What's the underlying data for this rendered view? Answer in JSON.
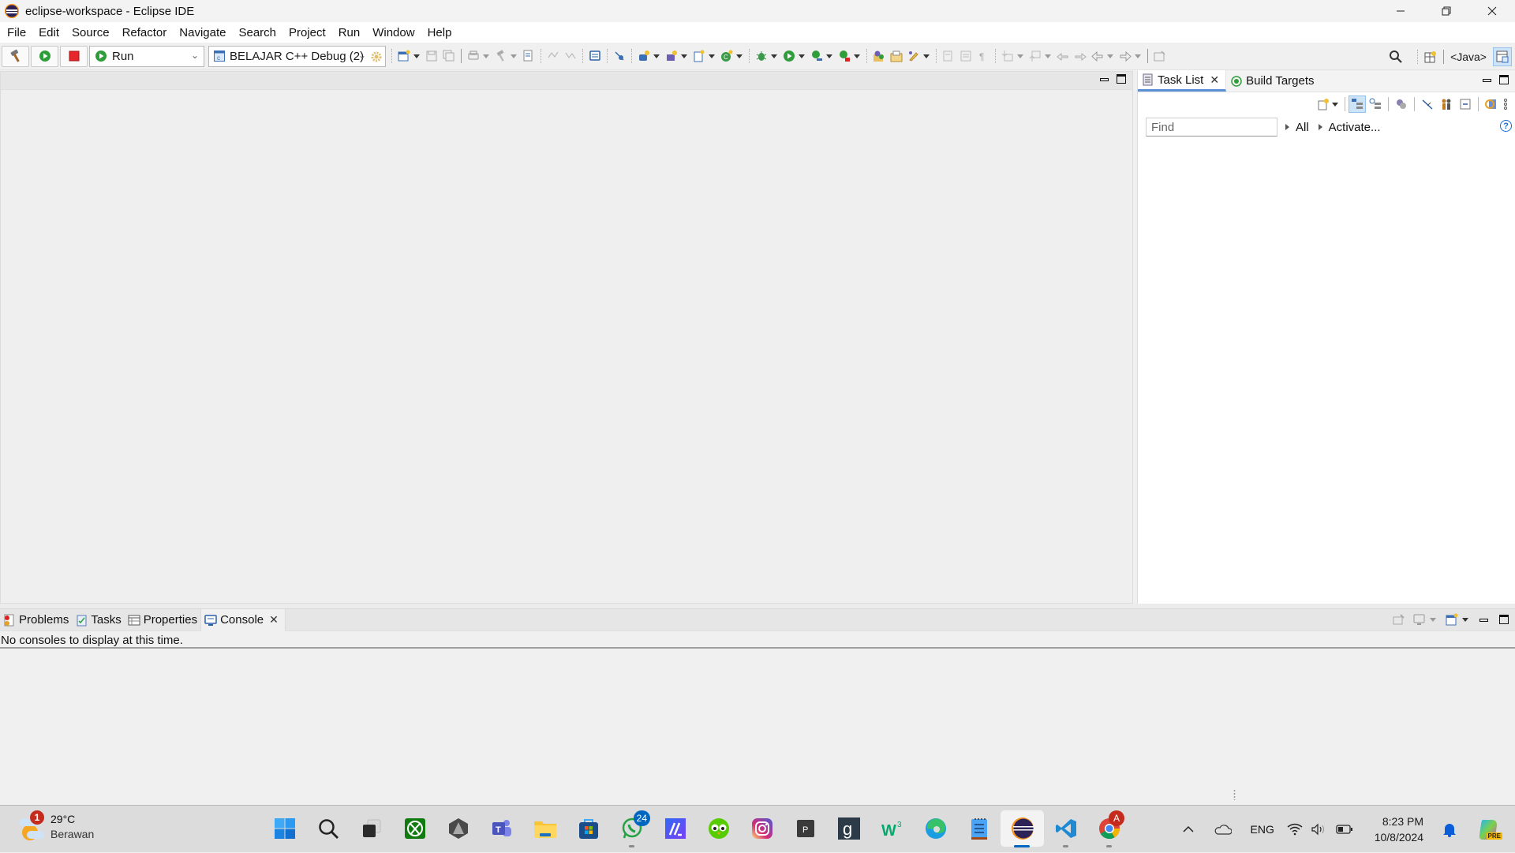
{
  "window": {
    "title": "eclipse-workspace - Eclipse IDE",
    "controls": [
      "minimize",
      "restore",
      "close"
    ]
  },
  "menubar": {
    "items": [
      "File",
      "Edit",
      "Source",
      "Refactor",
      "Navigate",
      "Search",
      "Project",
      "Run",
      "Window",
      "Help"
    ]
  },
  "toolbar": {
    "launch_mode": "Run",
    "launch_config": "BELAJAR C++ Debug (2)",
    "perspective_label": "<Java>",
    "icons": [
      "build-hammer-icon",
      "run-launch-icon",
      "stop-icon",
      "launch-mode-combo",
      "launch-config-combo",
      "launch-config-settings-icon",
      "new-wizard-icon",
      "save-icon",
      "save-all-icon",
      "print-icon",
      "build-icon",
      "open-task-icon",
      "undo-icon",
      "redo-icon",
      "toggle-console-icon",
      "skip-breakpoints-icon",
      "new-class-icon",
      "new-package-icon",
      "new-file-icon",
      "new-source-icon",
      "debug-icon",
      "run-icon",
      "coverage-icon",
      "external-tools-icon",
      "open-type-icon",
      "open-resource-icon",
      "search-pen-icon",
      "toggle-mark-icon",
      "block-selection-icon",
      "show-whitespace-icon",
      "next-annotation-icon",
      "prev-annotation-icon",
      "last-edit-icon",
      "back-icon",
      "forward-icon",
      "pin-editor-icon",
      "search-icon",
      "open-perspective-icon",
      "cpp-perspective-icon"
    ]
  },
  "right_panel": {
    "tabs": [
      {
        "label": "Task List",
        "active": true,
        "closable": true
      },
      {
        "label": "Build Targets",
        "active": false,
        "closable": false
      }
    ],
    "find_placeholder": "Find",
    "filter_all": "All",
    "activate": "Activate..."
  },
  "bottom_panel": {
    "tabs": [
      {
        "label": "Problems",
        "active": false
      },
      {
        "label": "Tasks",
        "active": false
      },
      {
        "label": "Properties",
        "active": false
      },
      {
        "label": "Console",
        "active": true,
        "closable": true
      }
    ],
    "message": "No consoles to display at this time."
  },
  "taskbar": {
    "weather": {
      "temperature": "29°C",
      "condition": "Berawan",
      "badge": "1"
    },
    "apps": [
      {
        "name": "start",
        "label": "Start"
      },
      {
        "name": "search",
        "label": "Search"
      },
      {
        "name": "task-view",
        "label": "Task View"
      },
      {
        "name": "xbox",
        "label": "Xbox"
      },
      {
        "name": "unity-hub",
        "label": "Unity Hub"
      },
      {
        "name": "teams",
        "label": "Microsoft Teams"
      },
      {
        "name": "file-explorer",
        "label": "File Explorer"
      },
      {
        "name": "microsoft-store",
        "label": "Microsoft Store"
      },
      {
        "name": "whatsapp",
        "label": "WhatsApp",
        "badge": "24",
        "running": true
      },
      {
        "name": "mathpix",
        "label": "Math App"
      },
      {
        "name": "duolingo",
        "label": "Duolingo"
      },
      {
        "name": "instagram",
        "label": "Instagram"
      },
      {
        "name": "pycharm-p",
        "label": "P App"
      },
      {
        "name": "goodnotes-g",
        "label": "G App"
      },
      {
        "name": "w3schools",
        "label": "W3Schools"
      },
      {
        "name": "edge",
        "label": "Microsoft Edge"
      },
      {
        "name": "notepad",
        "label": "Notepad"
      },
      {
        "name": "eclipse",
        "label": "Eclipse IDE",
        "active": true
      },
      {
        "name": "vscode",
        "label": "Visual Studio Code",
        "running": true
      },
      {
        "name": "chrome",
        "label": "Google Chrome",
        "badge": "A",
        "running": true
      }
    ],
    "tray": {
      "language": "ENG",
      "time": "8:23 PM",
      "date": "10/8/2024",
      "copilot_badge": "PRE"
    }
  }
}
